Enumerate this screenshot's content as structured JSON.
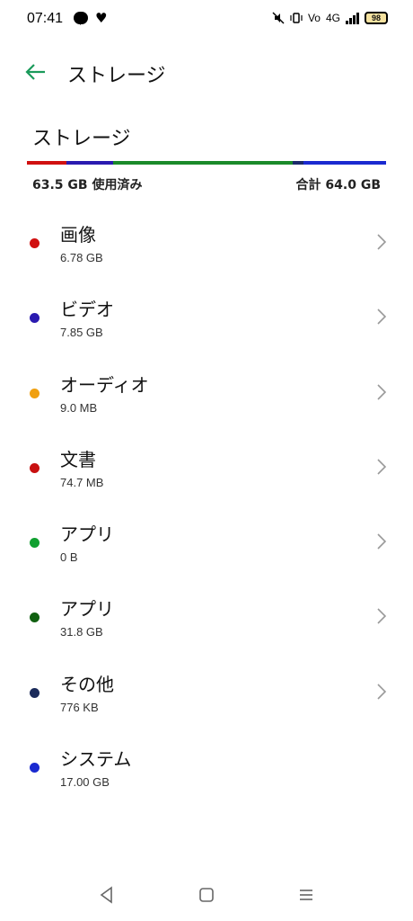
{
  "status_bar": {
    "time": "07:41",
    "battery": "98",
    "icons": [
      "line-icon",
      "heart-icon",
      "mute-icon",
      "vibrate-icon",
      "volte-icon",
      "4g-icon",
      "signal-icon",
      "battery-icon"
    ]
  },
  "app_bar": {
    "title": "ストレージ",
    "back_icon": "arrow-left-icon",
    "back_color": "#1a9a5a"
  },
  "storage": {
    "section_title": "ストレージ",
    "used_label": "63.5  GB 使用済み",
    "total_label": "合計 64.0 GB",
    "bar": [
      {
        "color": "#d01010",
        "fraction": 0.11
      },
      {
        "color": "#2a1ab0",
        "fraction": 0.13
      },
      {
        "color": "#1a8a2a",
        "fraction": 0.5
      },
      {
        "color": "#1a2a6a",
        "fraction": 0.03
      },
      {
        "color": "#1a2ad0",
        "fraction": 0.23
      }
    ]
  },
  "items": [
    {
      "title": "画像",
      "size": "6.78 GB",
      "color": "#d01010",
      "chevron": true
    },
    {
      "title": "ビデオ",
      "size": "7.85 GB",
      "color": "#2a1ab0",
      "chevron": true
    },
    {
      "title": "オーディオ",
      "size": "9.0 MB",
      "color": "#f0a010",
      "chevron": true
    },
    {
      "title": "文書",
      "size": "74.7 MB",
      "color": "#c81010",
      "chevron": true
    },
    {
      "title": "アプリ",
      "size": "0 B",
      "color": "#10a030",
      "chevron": true
    },
    {
      "title": "アプリ",
      "size": "31.8 GB",
      "color": "#106010",
      "chevron": true
    },
    {
      "title": "その他",
      "size": "776 KB",
      "color": "#1a2a5a",
      "chevron": true
    },
    {
      "title": "システム",
      "size": "17.00  GB",
      "color": "#1a2ad0",
      "chevron": false
    }
  ],
  "nav_bar": {
    "icons": [
      "back-triangle-icon",
      "home-square-icon",
      "recents-menu-icon"
    ]
  }
}
